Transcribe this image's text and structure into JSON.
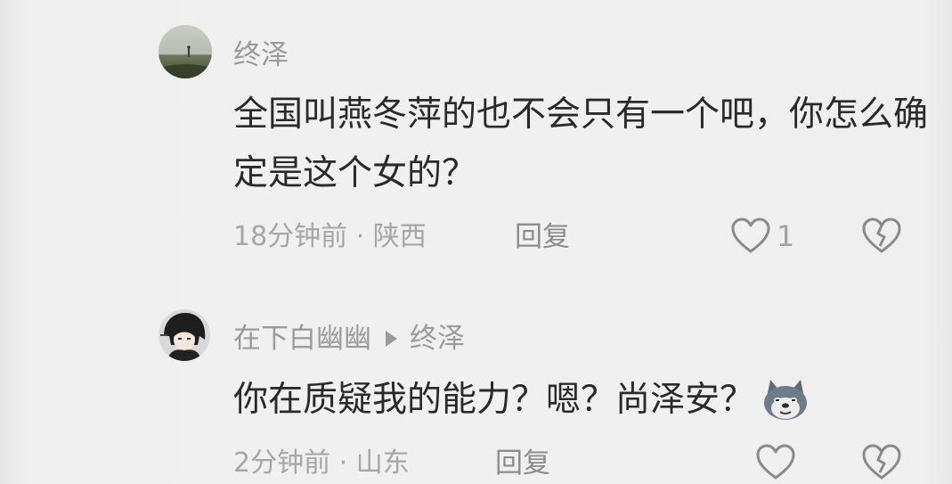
{
  "comments": [
    {
      "username": "终泽",
      "reply_to": "",
      "text": "全国叫燕冬萍的也不会只有一个吧，你怎么确定是这个女的？",
      "time_location": "18分钟前 · 陕西",
      "reply_label": "回复",
      "like_count": "1",
      "avatar_icon": "landscape-avatar"
    },
    {
      "username": "在下白幽幽",
      "reply_to": "终泽",
      "text": "你在质疑我的能力？嗯？尚泽安？",
      "emoji": "husky-dog-emoji",
      "time_location": "2分钟前 · 山东",
      "reply_label": "回复",
      "like_count": "",
      "avatar_icon": "anime-character-avatar"
    }
  ],
  "colors": {
    "username": "#9b9b9b",
    "text": "#2a2a2a",
    "meta": "#a6a6a6",
    "icon": "#8a8a8a"
  }
}
